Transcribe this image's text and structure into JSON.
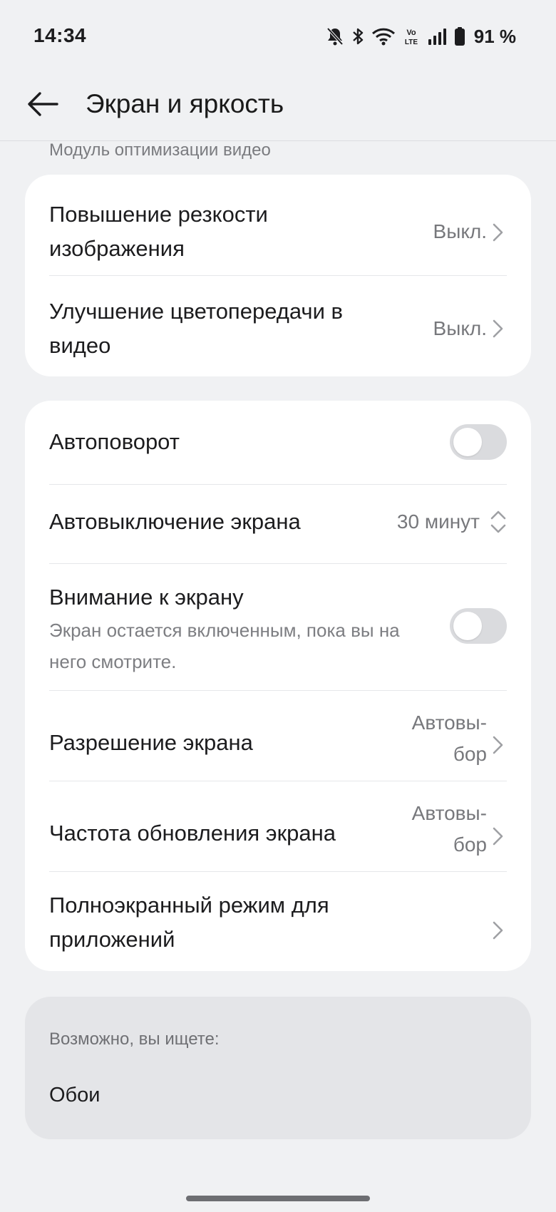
{
  "status_bar": {
    "time": "14:34",
    "network_label": "Vo LTE",
    "battery": "91 %"
  },
  "header": {
    "title": "Экран и яркость"
  },
  "video_section": {
    "label": "Модуль оптимизации видео",
    "items": [
      {
        "label": "Повышение резкости изображения",
        "value": "Выкл."
      },
      {
        "label": "Улучшение цветопередачи в видео",
        "value": "Выкл."
      }
    ]
  },
  "screen_section": {
    "auto_rotate": {
      "label": "Автоповорот",
      "enabled": false
    },
    "screen_timeout": {
      "label": "Автовыключение экрана",
      "value": "30 минут"
    },
    "screen_attention": {
      "label": "Внимание к экрану",
      "description": "Экран остается включенным, пока вы на него смотрите.",
      "enabled": false
    },
    "resolution": {
      "label": "Разрешение экрана",
      "value": "Автовы-бор"
    },
    "refresh_rate": {
      "label": "Частота обновления экрана",
      "value": "Автовы-бор"
    },
    "fullscreen_apps": {
      "label": "Полноэкранный режим для приложений"
    }
  },
  "suggestions": {
    "label": "Возможно, вы ищете:",
    "items": [
      "Обои"
    ]
  },
  "colors": {
    "background": "#f0f1f3",
    "card": "#ffffff",
    "toggle_off": "#dadbde",
    "secondary_text": "#77787c"
  }
}
